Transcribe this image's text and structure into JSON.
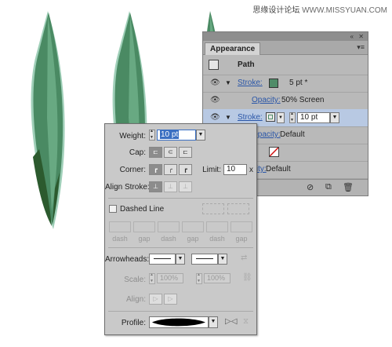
{
  "watermark": {
    "site": "思缘设计论坛",
    "url": "WWW.MISSYUAN.COM"
  },
  "appearance": {
    "tab": "Appearance",
    "double_arrow": "«",
    "close": "✕",
    "menu": "▾≡",
    "path_label": "Path",
    "rows": [
      {
        "label": "Stroke:",
        "value": "5 pt *"
      },
      {
        "label": "Opacity:",
        "value": "50% Screen"
      },
      {
        "label": "Stroke:",
        "value": "10 pt"
      },
      {
        "label": "Opacity:",
        "value": "Default"
      },
      {
        "label": "Opacity:",
        "value": "Default"
      }
    ],
    "colors": {
      "stroke_swatch": "#4f8c68",
      "highlight_row": "#b8c9e3"
    }
  },
  "stroke_panel": {
    "weight_label": "Weight:",
    "weight_value": "10 pt",
    "cap_label": "Cap:",
    "corner_label": "Corner:",
    "limit_label": "Limit:",
    "limit_value": "10",
    "limit_unit": "x",
    "align_label": "Align Stroke:",
    "dashed_label": "Dashed Line",
    "dash_labels": [
      "dash",
      "gap",
      "dash",
      "gap",
      "dash",
      "gap"
    ],
    "arrowheads_label": "Arrowheads:",
    "scale_label": "Scale:",
    "scale_1": "100%",
    "scale_2": "100%",
    "align2_label": "Align:",
    "profile_label": "Profile:"
  },
  "leaf_colors": {
    "body": "#4a8a63",
    "light": "#6fb089",
    "dark": "#2c5a2e",
    "edge": "#9fcfb8"
  }
}
